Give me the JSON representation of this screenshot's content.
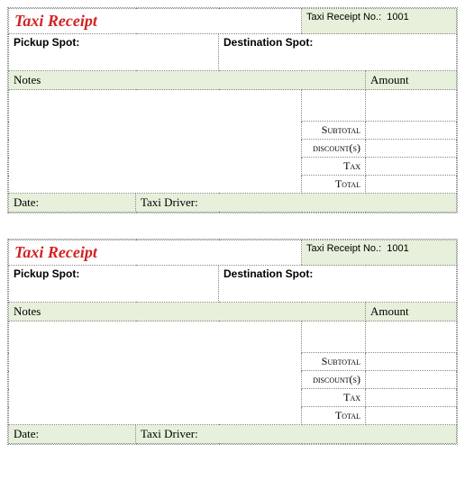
{
  "receipts": [
    {
      "title": "Taxi Receipt",
      "receipt_no_label": "Taxi Receipt No.:",
      "receipt_no_value": "1001",
      "pickup_label": "Pickup Spot:",
      "destination_label": "Destination Spot:",
      "notes_label": "Notes",
      "amount_label": "Amount",
      "subtotal_label": "Subtotal",
      "discounts_label": "discount(s)",
      "tax_label": "Tax",
      "total_label": "Total",
      "date_label": "Date:",
      "driver_label": "Taxi Driver:"
    },
    {
      "title": "Taxi Receipt",
      "receipt_no_label": "Taxi Receipt No.:",
      "receipt_no_value": "1001",
      "pickup_label": "Pickup Spot:",
      "destination_label": "Destination Spot:",
      "notes_label": "Notes",
      "amount_label": "Amount",
      "subtotal_label": "Subtotal",
      "discounts_label": "discount(s)",
      "tax_label": "Tax",
      "total_label": "Total",
      "date_label": "Date:",
      "driver_label": "Taxi Driver:"
    }
  ]
}
